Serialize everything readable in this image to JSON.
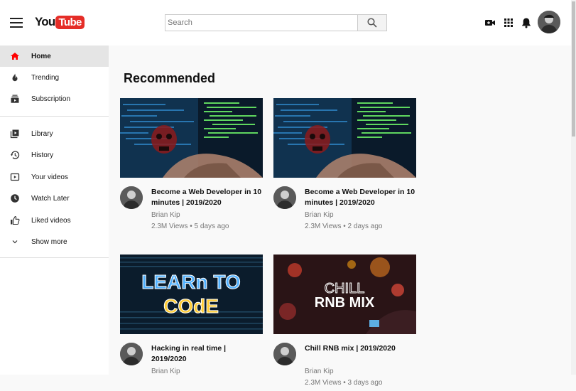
{
  "header": {
    "logo_you": "You",
    "logo_tube": "Tube",
    "search_placeholder": "Search"
  },
  "sidebar": {
    "items": [
      {
        "label": "Home",
        "icon": "home-icon",
        "active": true
      },
      {
        "label": "Trending",
        "icon": "trending-icon"
      },
      {
        "label": "Subscription",
        "icon": "subscription-icon"
      },
      {
        "label": "Library",
        "icon": "library-icon"
      },
      {
        "label": "History",
        "icon": "history-icon"
      },
      {
        "label": "Your videos",
        "icon": "your-videos-icon"
      },
      {
        "label": "Watch Later",
        "icon": "watch-later-icon"
      },
      {
        "label": "Liked videos",
        "icon": "like-icon"
      },
      {
        "label": "Show more",
        "icon": "chevron-down-icon"
      }
    ]
  },
  "main": {
    "section_title": "Recommended",
    "videos": [
      {
        "title": "Become a Web Developer in 10 minutes | 2019/2020",
        "channel": "Brian Kip",
        "stats": "2.3M Views • 5 days ago",
        "thumb": "hacker"
      },
      {
        "title": "Become a Web Developer in 10 minutes | 2019/2020",
        "channel": "Brian Kip",
        "stats": "2.3M Views • 2 days ago",
        "thumb": "hacker"
      },
      {
        "title": "Hacking in real time | 2019/2020",
        "channel": "Brian Kip",
        "stats": "",
        "thumb": "learn-to-code",
        "thumb_text": [
          "LEARn TO",
          "COdE"
        ]
      },
      {
        "title": "Chill RNB mix | 2019/2020",
        "channel": "Brian Kip",
        "stats": "2.3M Views • 3 days ago",
        "thumb": "rnb",
        "thumb_text": [
          "CHILL",
          "RNB MIX"
        ]
      }
    ]
  },
  "colors": {
    "brand_red": "#e52d27",
    "active_bg": "#e5e5e5",
    "secondary_text": "#777777"
  }
}
